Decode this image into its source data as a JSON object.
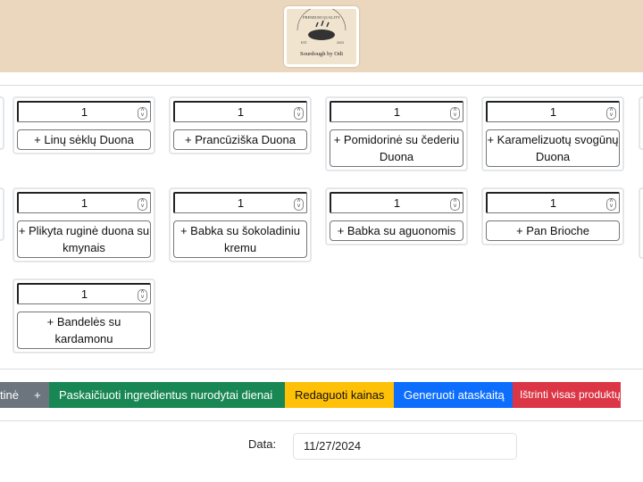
{
  "header": {
    "logo": {
      "top_text": "PREMIUM QUALITY",
      "est": "EST.",
      "year": "2023",
      "brand": "Sourdough by Odi"
    },
    "background": "#ead7bd"
  },
  "products": [
    {
      "qty": "1",
      "label": "+ Linų sėklų Duona"
    },
    {
      "qty": "1",
      "label": "+ Prancūziška Duona"
    },
    {
      "qty": "1",
      "label": "+ Pomidorinė su čederiu Duona"
    },
    {
      "qty": "1",
      "label": "+ Karamelizuotų svogūnų Duona"
    },
    {
      "qty": "1",
      "label": "+ Plikyta ruginė duona su kmynais"
    },
    {
      "qty": "1",
      "label": "+ Babka su šokoladiniu kremu"
    },
    {
      "qty": "1",
      "label": "+ Babka su aguonomis"
    },
    {
      "qty": "1",
      "label": "+ Pan Brioche"
    },
    {
      "qty": "1",
      "label": "+ Bandelės su kardamonu"
    }
  ],
  "actions": [
    {
      "label": "tinė",
      "color": "#6c757d"
    },
    {
      "label": "+",
      "color": "#6c757d"
    },
    {
      "label": "Paskaičiuoti ingredientus nurodytai dienai",
      "color": "#198754"
    },
    {
      "label": "Redaguoti kainas",
      "color": "#ffc107"
    },
    {
      "label": "Generuoti ataskaitą",
      "color": "#0d6efd"
    },
    {
      "label": "Ištrinti visas produktų",
      "color": "#dc3545"
    }
  ],
  "date": {
    "label": "Data:",
    "value": "11/27/2024"
  }
}
